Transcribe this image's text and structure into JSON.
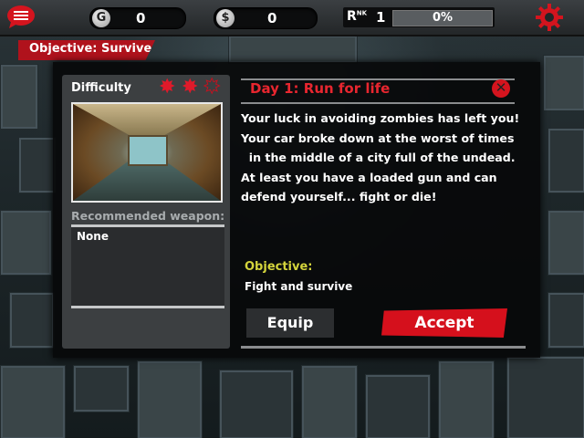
{
  "topbar": {
    "menu_icon": "chat-menu-icon",
    "gold": {
      "icon_letter": "G",
      "value": "0"
    },
    "cash": {
      "icon_letter": "$",
      "value": "0"
    },
    "rank": {
      "label": "R",
      "label_sup": "NK",
      "value": "1",
      "progress_text": "0%",
      "progress": 0
    },
    "settings_icon": "gear-icon"
  },
  "banner": {
    "label": "Objective: Survive"
  },
  "mission": {
    "difficulty_label": "Difficulty",
    "difficulty_stars": 2,
    "difficulty_max": 3,
    "recommended_label": "Recommended weapon:",
    "recommended_weapon": "None",
    "title": "Day 1: Run for life",
    "description_lines": [
      "Your luck in avoiding zombies has left you!",
      "Your car broke down at the worst of times",
      "  in the middle of a city full of the undead.",
      "At least you have a loaded gun and can",
      "defend yourself... fight or die!"
    ],
    "objective_label": "Objective:",
    "objective_text": "Fight and survive"
  },
  "buttons": {
    "equip": "Equip",
    "accept": "Accept"
  },
  "colors": {
    "accent_red": "#d5101c",
    "objective_yellow": "#d4d43c",
    "panel_gray": "#3c3f41"
  }
}
